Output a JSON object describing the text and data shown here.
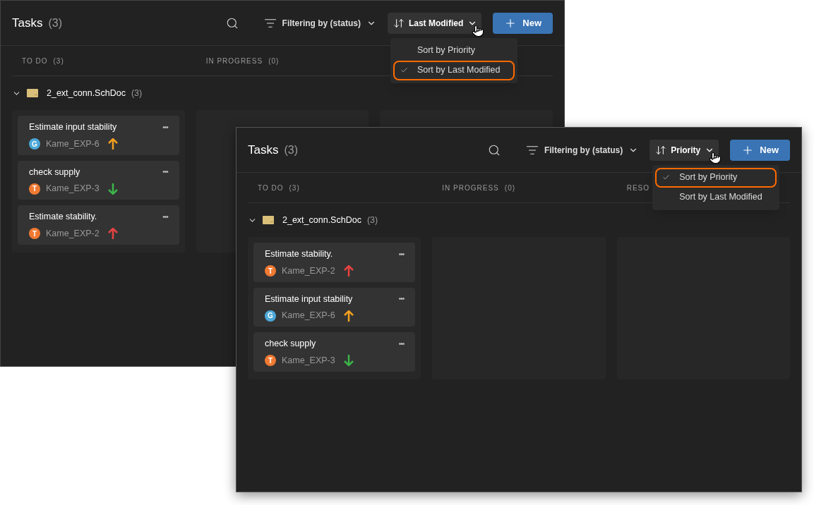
{
  "windows": [
    {
      "title": "Tasks",
      "count": "(3)",
      "filter": "Filtering by (status)",
      "sort_label": "Last Modified",
      "new_button": "New",
      "menu": [
        {
          "label": "Sort by Priority",
          "selected": false,
          "highlighted": false
        },
        {
          "label": "Sort by Last Modified",
          "selected": true,
          "highlighted": true
        }
      ],
      "columns": [
        {
          "kind": "header",
          "label": "TO DO",
          "count": "(3)"
        },
        {
          "kind": "header",
          "label": "IN PROGRESS",
          "count": "(0)"
        },
        {
          "kind": "blank"
        }
      ],
      "group": {
        "name": "2_ext_conn.SchDoc",
        "count": "(3)",
        "expanded": true
      },
      "tasks": [
        {
          "title": "Estimate input stability",
          "more": "•••",
          "avatar": {
            "initial": "G",
            "color": "#4ca8d8"
          },
          "assignee": "Kame_EXP-6",
          "priority": {
            "kind": "up",
            "color": "#f0a020"
          }
        },
        {
          "title": "check supply",
          "more": "•••",
          "avatar": {
            "initial": "T",
            "color": "#f07a32"
          },
          "assignee": "Kame_EXP-3",
          "priority": {
            "kind": "down",
            "color": "#3cb54a"
          }
        },
        {
          "title": "Estimate stability.",
          "more": "•••",
          "avatar": {
            "initial": "T",
            "color": "#f07a32"
          },
          "assignee": "Kame_EXP-2",
          "priority": {
            "kind": "up",
            "color": "#e84242"
          }
        }
      ]
    },
    {
      "title": "Tasks",
      "count": "(3)",
      "filter": "Filtering by (status)",
      "sort_label": "Priority",
      "new_button": "New",
      "menu": [
        {
          "label": "Sort by Priority",
          "selected": true,
          "highlighted": true
        },
        {
          "label": "Sort by Last Modified",
          "selected": false,
          "highlighted": false
        }
      ],
      "columns": [
        {
          "kind": "header",
          "label": "TO DO",
          "count": "(3)"
        },
        {
          "kind": "header",
          "label": "IN PROGRESS",
          "count": "(0)"
        },
        {
          "kind": "header",
          "label": "RESO"
        }
      ],
      "group": {
        "name": "2_ext_conn.SchDoc",
        "count": "(3)",
        "expanded": true
      },
      "tasks": [
        {
          "title": "Estimate stability.",
          "more": "•••",
          "avatar": {
            "initial": "T",
            "color": "#f07a32"
          },
          "assignee": "Kame_EXP-2",
          "priority": {
            "kind": "up",
            "color": "#e84242"
          }
        },
        {
          "title": "Estimate input stability",
          "more": "•••",
          "avatar": {
            "initial": "G",
            "color": "#4ca8d8"
          },
          "assignee": "Kame_EXP-6",
          "priority": {
            "kind": "up",
            "color": "#f0a020"
          }
        },
        {
          "title": "check supply",
          "more": "•••",
          "avatar": {
            "initial": "T",
            "color": "#f07a32"
          },
          "assignee": "Kame_EXP-3",
          "priority": {
            "kind": "down",
            "color": "#3cb54a"
          }
        }
      ]
    }
  ]
}
